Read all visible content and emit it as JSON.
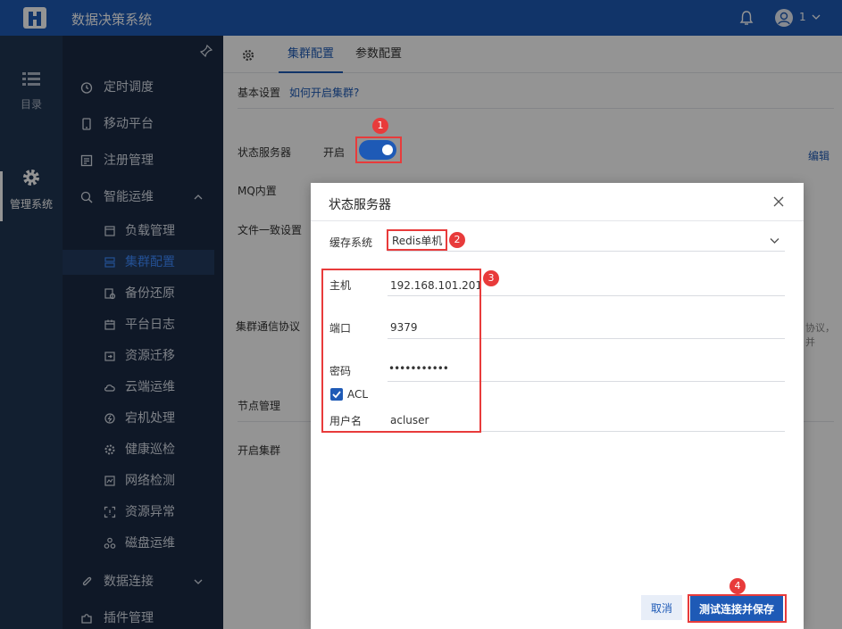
{
  "app": {
    "title": "数据决策系统",
    "user_number": "1"
  },
  "rail": [
    {
      "label": "目录",
      "icon": "list-icon",
      "active": false
    },
    {
      "label": "管理系统",
      "icon": "gear-icon",
      "active": true
    }
  ],
  "nav": {
    "items": [
      {
        "label": "定时调度",
        "icon": "clock-icon"
      },
      {
        "label": "移动平台",
        "icon": "mobile-icon"
      },
      {
        "label": "注册管理",
        "icon": "register-icon"
      },
      {
        "label": "智能运维",
        "icon": "ops-icon",
        "expanded": true
      }
    ],
    "sub_items": [
      {
        "label": "负载管理",
        "active": false
      },
      {
        "label": "集群配置",
        "active": true
      },
      {
        "label": "备份还原",
        "active": false
      },
      {
        "label": "平台日志",
        "active": false
      },
      {
        "label": "资源迁移",
        "active": false
      },
      {
        "label": "云端运维",
        "active": false
      },
      {
        "label": "宕机处理",
        "active": false
      },
      {
        "label": "健康巡检",
        "active": false
      },
      {
        "label": "网络检测",
        "active": false
      },
      {
        "label": "资源异常",
        "active": false
      },
      {
        "label": "磁盘运维",
        "active": false
      }
    ],
    "bottom_items": [
      {
        "label": "数据连接",
        "icon": "link-icon"
      },
      {
        "label": "插件管理",
        "icon": "plugin-icon"
      }
    ]
  },
  "tabs": [
    {
      "label": "集群配置",
      "active": true
    },
    {
      "label": "参数配置",
      "active": false
    }
  ],
  "settings": {
    "section_basic": "基本设置",
    "cluster_help_link": "如何开启集群?",
    "state_server_label": "状态服务器",
    "state_server_status": "开启",
    "mq_label": "MQ内置",
    "file_consistency_label": "文件一致设置",
    "cluster_protocol_label": "集群通信协议",
    "truncated_text": "协议，并",
    "edit_link": "编辑",
    "section_node": "节点管理",
    "enable_cluster_label": "开启集群"
  },
  "dialog": {
    "title": "状态服务器",
    "cache_system_label": "缓存系统",
    "cache_system_value": "Redis单机",
    "host_label": "主机",
    "host_value": "192.168.101.201",
    "port_label": "端口",
    "port_value": "9379",
    "password_label": "密码",
    "password_value": "•••••••••••",
    "acl_label": "ACL",
    "acl_checked": true,
    "username_label": "用户名",
    "username_value": "acluser",
    "cancel_label": "取消",
    "save_label": "测试连接并保存"
  },
  "annotations": [
    "1",
    "2",
    "3",
    "4"
  ],
  "colors": {
    "primary": "#1e5ab6",
    "annotation": "#e83b3b",
    "nav_bg": "#1b2a44",
    "rail_bg": "#203654"
  }
}
